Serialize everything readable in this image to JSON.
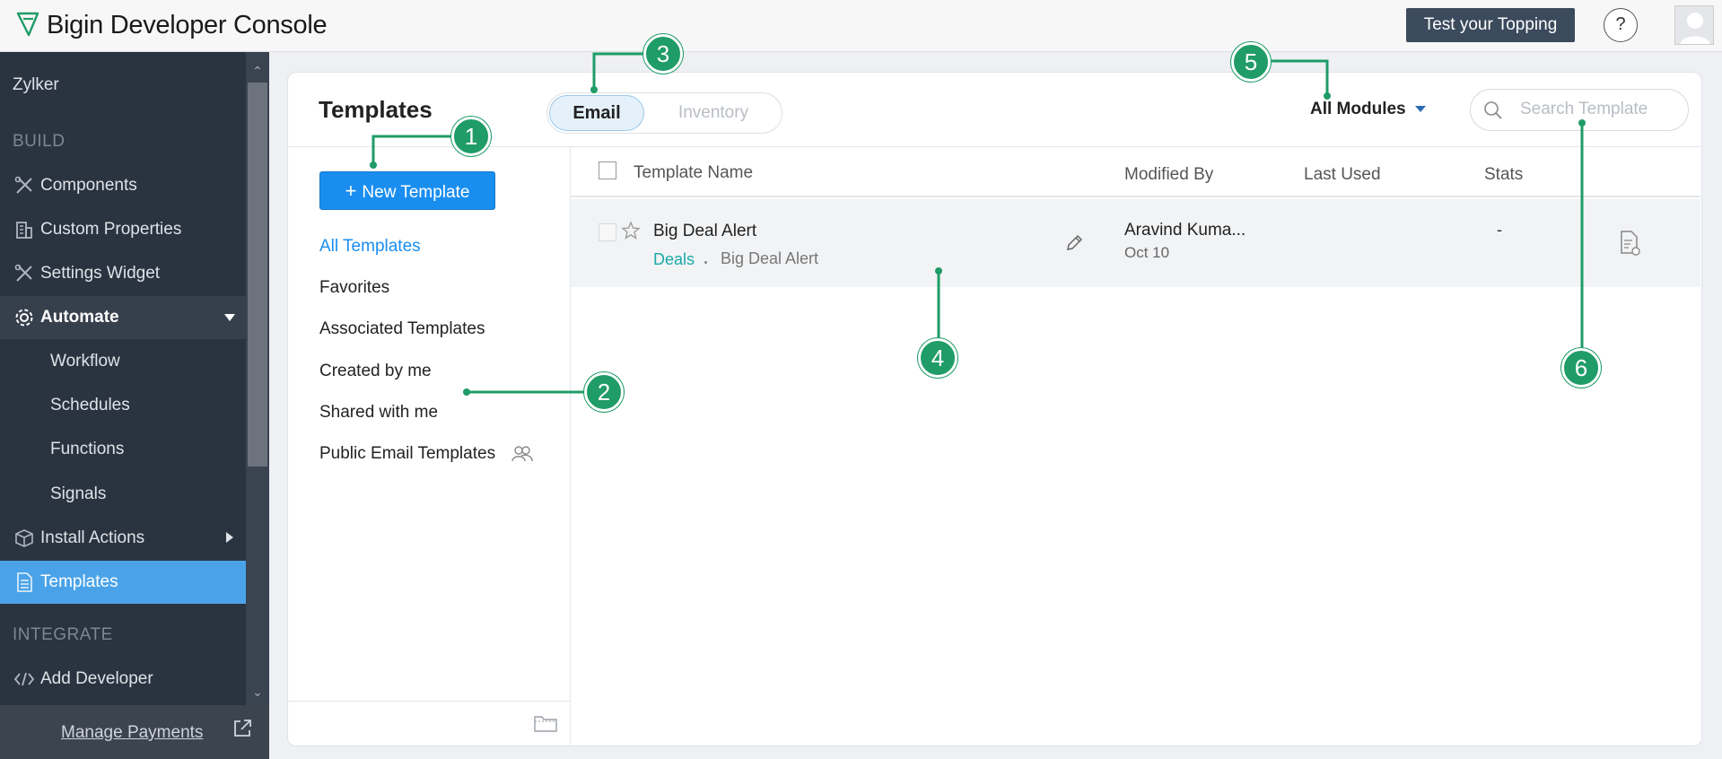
{
  "header": {
    "app_title": "Bigin Developer Console",
    "test_button": "Test your Topping",
    "help_label": "?"
  },
  "sidebar": {
    "org_name": "Zylker",
    "sections": {
      "build": "BUILD",
      "integrate": "INTEGRATE"
    },
    "items": {
      "components": "Components",
      "custom_properties": "Custom Properties",
      "settings_widget": "Settings Widget",
      "automate": "Automate",
      "workflow": "Workflow",
      "schedules": "Schedules",
      "functions": "Functions",
      "signals": "Signals",
      "install_actions": "Install Actions",
      "templates": "Templates",
      "add_developer": "Add Developer"
    },
    "manage_payments": "Manage Payments"
  },
  "main": {
    "title": "Templates",
    "tabs": {
      "email": "Email",
      "inventory": "Inventory"
    },
    "modules_label": "All Modules",
    "search_placeholder": "Search Template",
    "new_template": "New Template",
    "filters": {
      "all": "All Templates",
      "favorites": "Favorites",
      "associated": "Associated Templates",
      "created": "Created by me",
      "shared": "Shared with me",
      "public": "Public Email Templates"
    },
    "table": {
      "headers": {
        "name": "Template Name",
        "modified_by": "Modified By",
        "last_used": "Last Used",
        "stats": "Stats"
      },
      "rows": [
        {
          "name": "Big Deal Alert",
          "module": "Deals",
          "subtitle": "Big Deal Alert",
          "modified_by": "Aravind Kuma...",
          "modified_date": "Oct 10",
          "last_used": "",
          "stats": "-"
        }
      ]
    }
  },
  "callouts": {
    "c1": "1",
    "c2": "2",
    "c3": "3",
    "c4": "4",
    "c5": "5",
    "c6": "6"
  },
  "colors": {
    "accent": "#1a8ef0",
    "sidebar": "#2a3340",
    "selected": "#4aa3e8",
    "callout": "#1f9c67",
    "module_link": "#1aa9a9"
  }
}
